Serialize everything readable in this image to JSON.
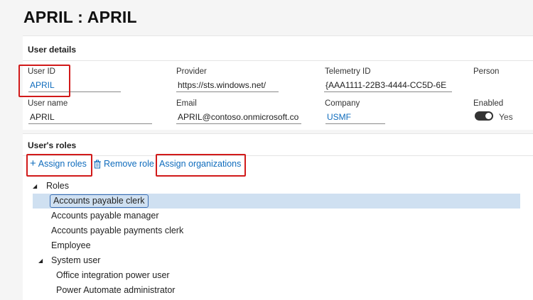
{
  "page": {
    "title": "APRIL : APRIL"
  },
  "user_details": {
    "section_title": "User details",
    "fields": {
      "user_id": {
        "label": "User ID",
        "value": "APRIL"
      },
      "provider": {
        "label": "Provider",
        "value": "https://sts.windows.net/"
      },
      "telemetry_id": {
        "label": "Telemetry ID",
        "value": "{AAA1111-22B3-4444-CC5D-6E"
      },
      "person": {
        "label": "Person"
      },
      "user_name": {
        "label": "User name",
        "value": "APRIL"
      },
      "email": {
        "label": "Email",
        "value": "APRIL@contoso.onmicrosoft.co"
      },
      "company": {
        "label": "Company",
        "value": "USMF"
      },
      "enabled": {
        "label": "Enabled",
        "value": "Yes",
        "on": true
      }
    }
  },
  "roles_section": {
    "section_title": "User's roles",
    "actions": {
      "assign_roles": "Assign roles",
      "remove_role": "Remove role",
      "assign_organizations": "Assign organizations"
    },
    "tree": {
      "root": "Roles",
      "items": [
        "Accounts payable clerk",
        "Accounts payable manager",
        "Accounts payable payments clerk",
        "Employee"
      ],
      "system_user": "System user",
      "system_children": [
        "Office integration power user",
        "Power Automate administrator"
      ]
    }
  },
  "colors": {
    "accent": "#0f6cbd",
    "highlight_box": "#d11a1a",
    "selected_row": "#cfe0f1"
  }
}
